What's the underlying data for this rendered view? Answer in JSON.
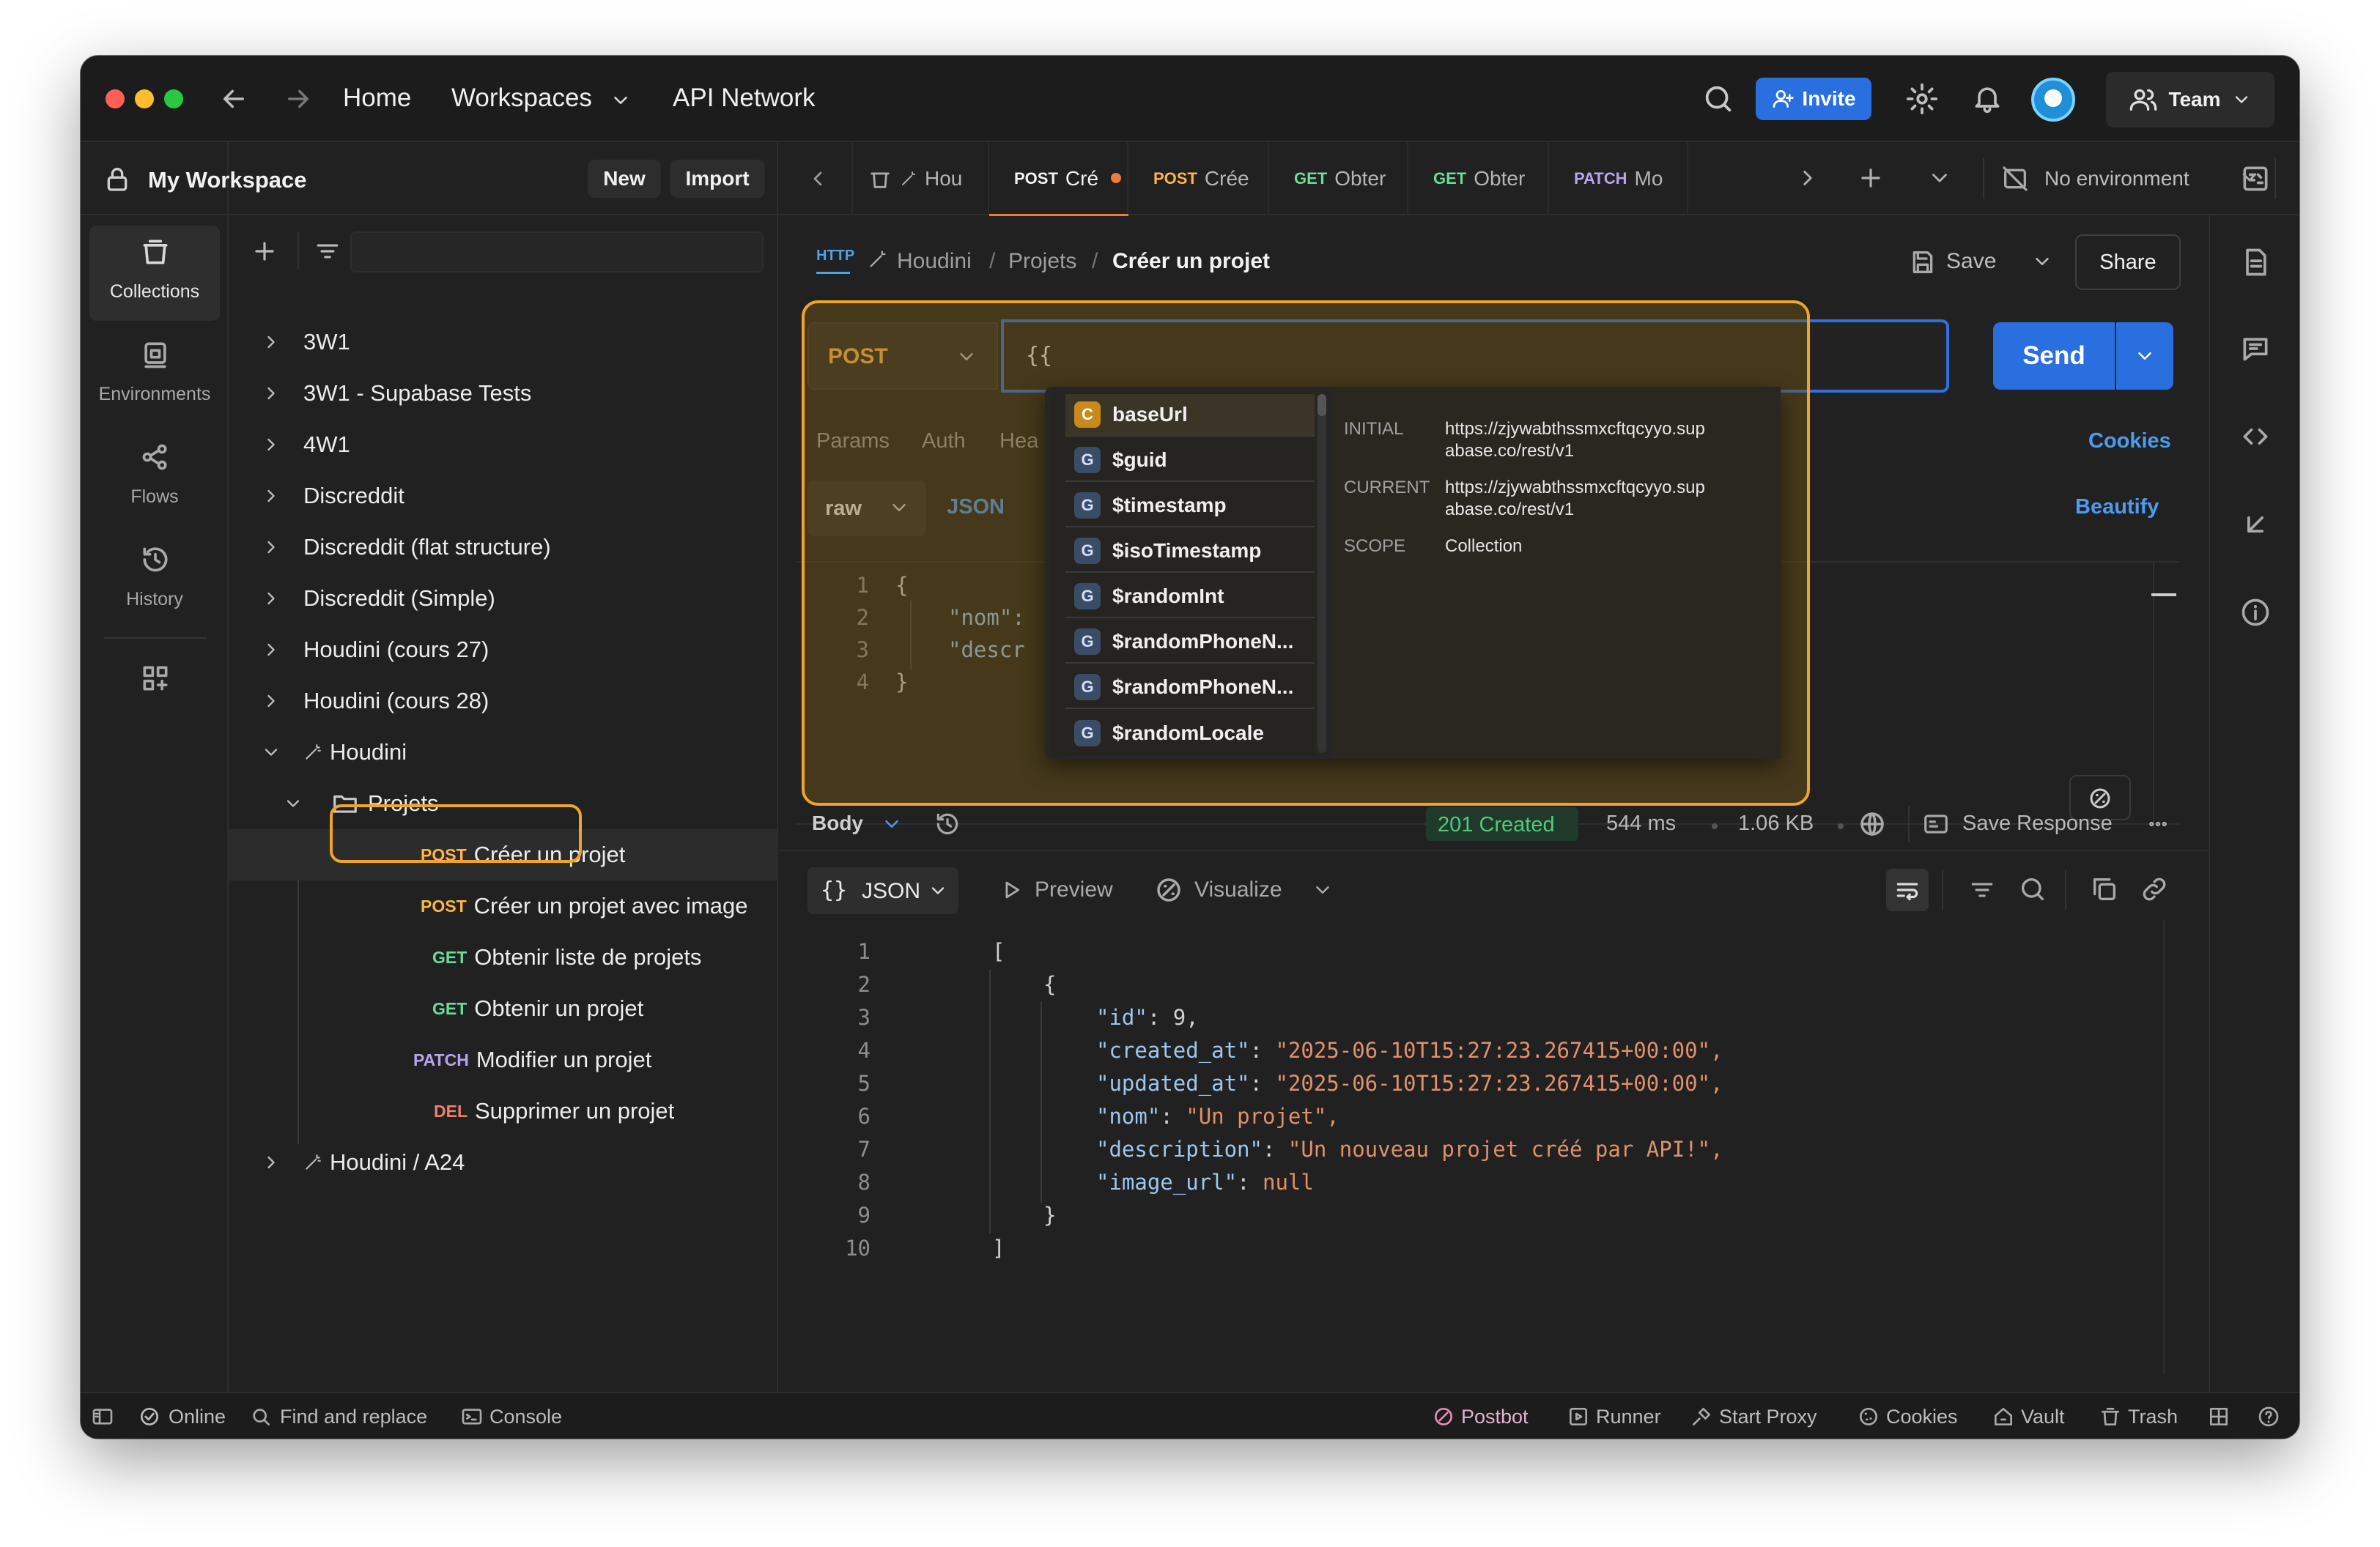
{
  "topbar": {
    "home": "Home",
    "workspaces": "Workspaces",
    "api_network": "API Network",
    "invite": "Invite",
    "team": "Team"
  },
  "workspace": {
    "name": "My Workspace",
    "new_label": "New",
    "import_label": "Import"
  },
  "sidebar_nav": [
    {
      "label": "Collections",
      "icon": "collections-icon"
    },
    {
      "label": "Environments",
      "icon": "environments-icon"
    },
    {
      "label": "Flows",
      "icon": "flows-icon"
    },
    {
      "label": "History",
      "icon": "history-icon"
    }
  ],
  "tree": {
    "collections": [
      "3W1",
      "3W1 - Supabase Tests",
      "4W1",
      "Discreddit",
      "Discreddit (flat structure)",
      "Discreddit (Simple)",
      "Houdini (cours 27)",
      "Houdini (cours 28)"
    ],
    "houdini": "Houdini",
    "folder": "Projets",
    "requests": [
      {
        "method": "POST",
        "name": "Créer un projet"
      },
      {
        "method": "POST",
        "name": "Créer un projet avec image"
      },
      {
        "method": "GET",
        "name": "Obtenir liste de projets"
      },
      {
        "method": "GET",
        "name": "Obtenir un projet"
      },
      {
        "method": "PATCH",
        "name": "Modifier un projet"
      },
      {
        "method": "DEL",
        "name": "Supprimer un projet"
      }
    ],
    "last": "Houdini / A24"
  },
  "tabs": [
    {
      "method": "",
      "name": "Hou"
    },
    {
      "method": "POST",
      "name": "Cré"
    },
    {
      "method": "POST",
      "name": "Crée"
    },
    {
      "method": "GET",
      "name": "Obter"
    },
    {
      "method": "GET",
      "name": "Obter"
    },
    {
      "method": "PATCH",
      "name": "Mo"
    }
  ],
  "environment": "No environment",
  "breadcrumb": {
    "root": "Houdini",
    "sep": "/",
    "folder": "Projets",
    "current": "Créer un projet"
  },
  "actions": {
    "save": "Save",
    "share": "Share"
  },
  "request": {
    "method": "POST",
    "url": "{{",
    "send": "Send",
    "tabs": [
      "Params",
      "Auth",
      "Hea"
    ],
    "cookies": "Cookies",
    "body_mode": "raw",
    "body_format": "JSON",
    "beautify": "Beautify",
    "body_lines": [
      "{",
      "\"nom\":",
      "\"descr",
      "}"
    ],
    "line_numbers": [
      "1",
      "2",
      "3",
      "4"
    ]
  },
  "autocomplete": {
    "items": [
      {
        "badge": "C",
        "name": "baseUrl"
      },
      {
        "badge": "G",
        "name": "$guid"
      },
      {
        "badge": "G",
        "name": "$timestamp"
      },
      {
        "badge": "G",
        "name": "$isoTimestamp"
      },
      {
        "badge": "G",
        "name": "$randomInt"
      },
      {
        "badge": "G",
        "name": "$randomPhoneN..."
      },
      {
        "badge": "G",
        "name": "$randomPhoneN..."
      },
      {
        "badge": "G",
        "name": "$randomLocale"
      }
    ],
    "initial_label": "INITIAL",
    "initial_value_1": "https://zjywabthssmxcftqcyyo.sup",
    "initial_value_2": "abase.co/rest/v1",
    "current_label": "CURRENT",
    "current_value_1": "https://zjywabthssmxcftqcyyo.sup",
    "current_value_2": "abase.co/rest/v1",
    "scope_label": "SCOPE",
    "scope_value": "Collection"
  },
  "response": {
    "body_label": "Body",
    "status": "201 Created",
    "time": "544 ms",
    "size": "1.06 KB",
    "save_response": "Save Response",
    "format": "JSON",
    "preview": "Preview",
    "visualize": "Visualize",
    "line_numbers": [
      "1",
      "2",
      "3",
      "4",
      "5",
      "6",
      "7",
      "8",
      "9",
      "10"
    ],
    "lines": [
      {
        "key": "",
        "val": "["
      },
      {
        "key": "",
        "val": "{"
      },
      {
        "key": "\"id\"",
        "val": "9,"
      },
      {
        "key": "\"created_at\"",
        "val": "\"2025-06-10T15:27:23.267415+00:00\","
      },
      {
        "key": "\"updated_at\"",
        "val": "\"2025-06-10T15:27:23.267415+00:00\","
      },
      {
        "key": "\"nom\"",
        "val": "\"Un projet\","
      },
      {
        "key": "\"description\"",
        "val": "\"Un nouveau projet créé par API!\","
      },
      {
        "key": "\"image_url\"",
        "val": "null"
      },
      {
        "key": "",
        "val": "}"
      },
      {
        "key": "",
        "val": "]"
      }
    ]
  },
  "statusbar": {
    "online": "Online",
    "find_replace": "Find and replace",
    "console": "Console",
    "postbot": "Postbot",
    "runner": "Runner",
    "start_proxy": "Start Proxy",
    "cookies": "Cookies",
    "vault": "Vault",
    "trash": "Trash"
  },
  "colors": {
    "accent_blue": "#2a6fe0",
    "highlight_orange": "#f0a429",
    "post": "#ffb547",
    "get": "#6bdd9a",
    "patch": "#b7a3ee",
    "del": "#f0806b",
    "status_ok": "#52c97b"
  }
}
